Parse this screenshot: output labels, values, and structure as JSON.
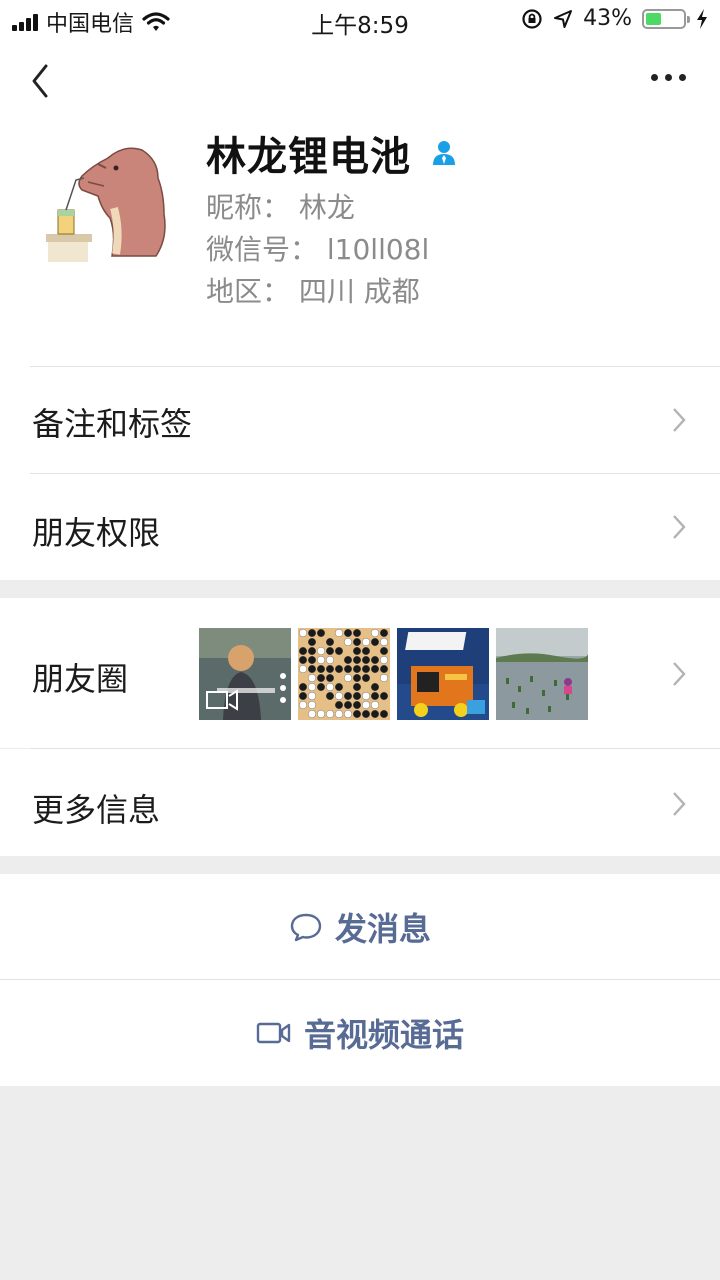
{
  "status_bar": {
    "carrier": "中国电信",
    "time": "上午8:59",
    "battery_percent": "43%",
    "battery_level": 0.43
  },
  "profile": {
    "name": "林龙锂电池",
    "nickname": "昵称：  林龙",
    "wechat_id": "微信号：  l10ll08l",
    "region": "地区：  四川 成都"
  },
  "menu": {
    "notes_tags": "备注和标签",
    "friend_permissions": "朋友权限",
    "moments": "朋友圈",
    "more_info": "更多信息"
  },
  "actions": {
    "send_message": "发消息",
    "av_call": "音视频通话"
  },
  "colors": {
    "accent": "#576b95",
    "battery": "#4cd964",
    "verify_badge": "#1aa0e6"
  }
}
